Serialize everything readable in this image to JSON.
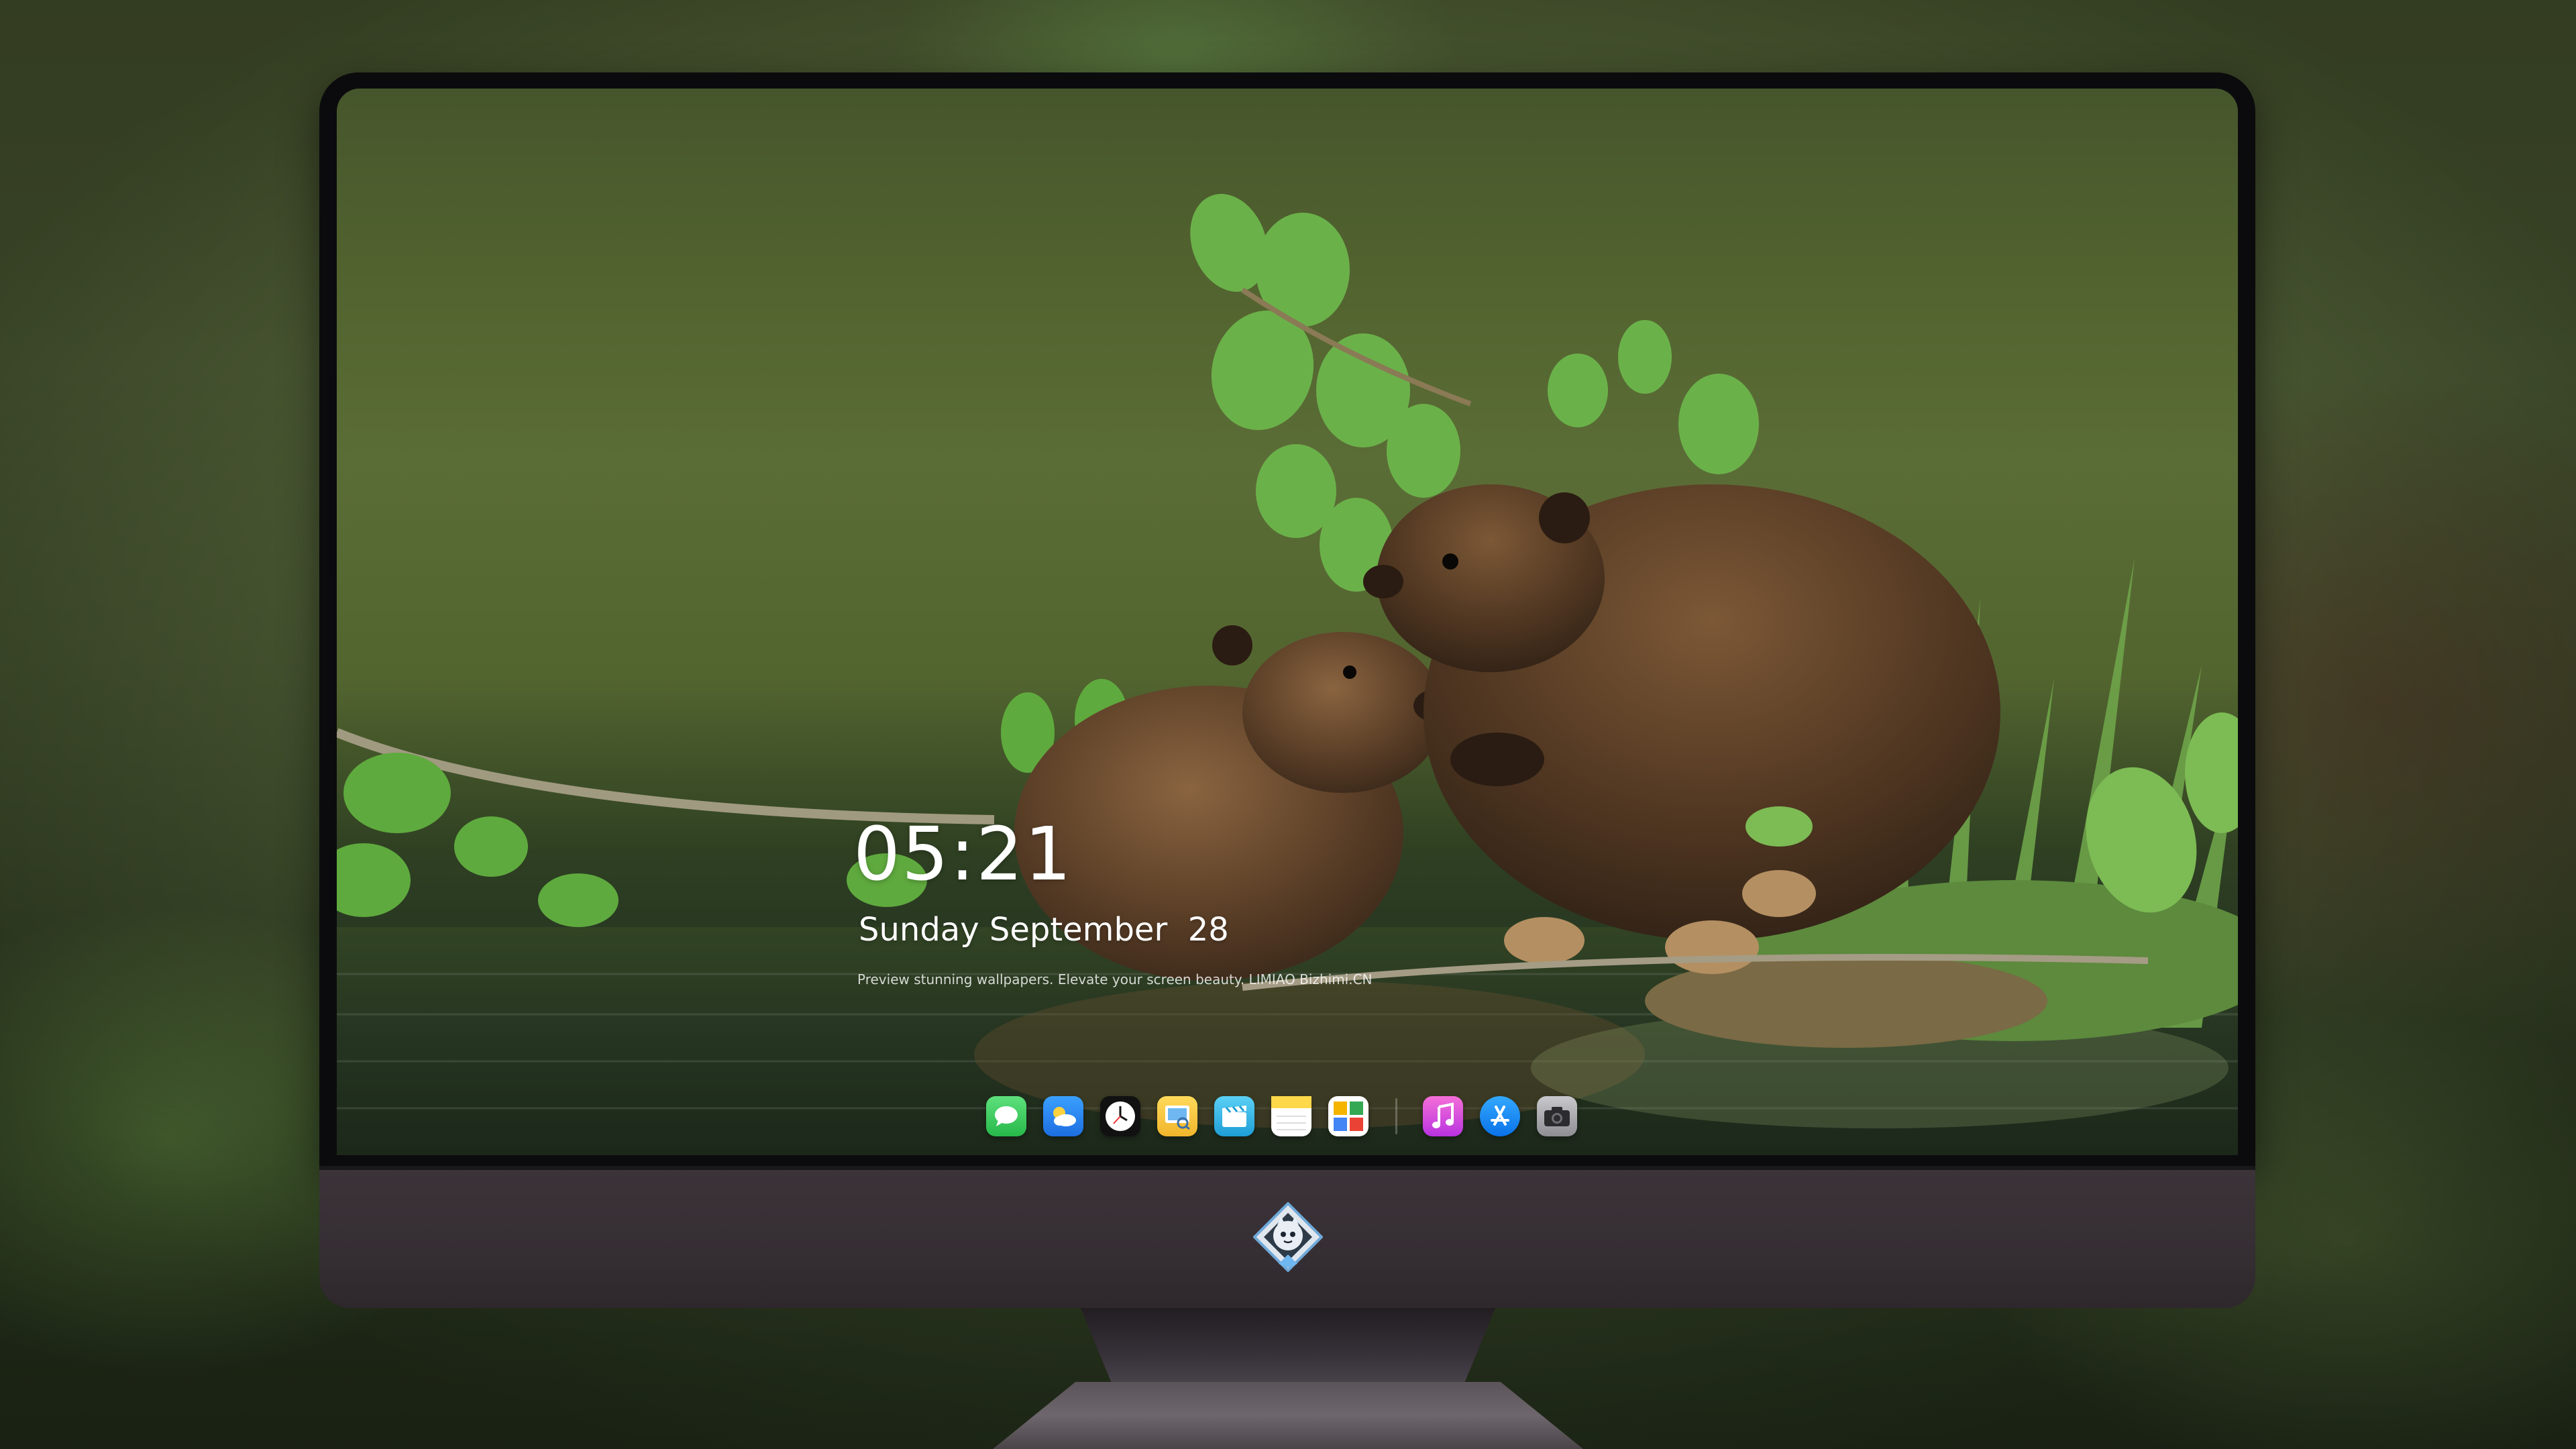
{
  "lockscreen": {
    "time": "05:21",
    "date": "Sunday September  28",
    "caption": "Preview stunning wallpapers. Elevate your screen beauty. LIMIAO  Bizhimi.CN"
  },
  "dock": {
    "apps": [
      {
        "name": "messages-icon",
        "color": "#34c759"
      },
      {
        "name": "weather-icon",
        "color": "#2a8cf0"
      },
      {
        "name": "clock-icon",
        "color": "#111111"
      },
      {
        "name": "preview-icon",
        "color": "#f2c240"
      },
      {
        "name": "clips-icon",
        "color": "#38b6e8"
      },
      {
        "name": "notes-icon",
        "color": "#ffd84a"
      },
      {
        "name": "photos-icon",
        "color": "#ffffff"
      },
      {
        "name": "music-icon",
        "color": "#e049d1"
      },
      {
        "name": "app-store-icon",
        "color": "#1c8df5"
      },
      {
        "name": "camera-icon",
        "color": "#8e8e93"
      }
    ]
  },
  "colors": {
    "bezel": "#0b0b0d",
    "chin": "#3b3338",
    "water": "#1f2b1c"
  }
}
